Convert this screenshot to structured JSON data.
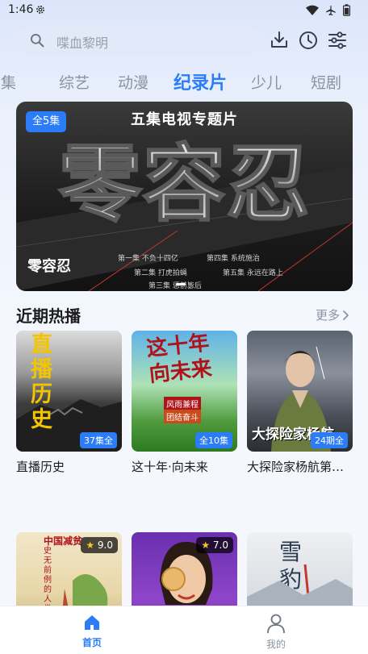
{
  "status_bar": {
    "time": "1:46"
  },
  "search": {
    "placeholder": "喋血黎明"
  },
  "tabs": [
    "剧集",
    "综艺",
    "动漫",
    "纪录片",
    "少儿",
    "短剧"
  ],
  "banner": {
    "badge": "全5集",
    "subtitle": "五集电视专题片",
    "big_title": "零容忍",
    "title": "零容忍",
    "episodes": [
      "第一集 不负十四亿",
      "第二集 打虎拍蝇",
      "第三集 惩前毖后",
      "第四集 系统施治",
      "第五集 永远在路上"
    ]
  },
  "section": {
    "title": "近期热播",
    "more": "更多"
  },
  "cards": [
    {
      "title": "直播历史",
      "badge": "37集全",
      "poster_text": "直播历史"
    },
    {
      "title": "这十年·向未来",
      "badge": "全10集",
      "poster_text": "这十年向未来",
      "poster_sub1": "风雨兼程",
      "poster_sub2": "团结奋斗"
    },
    {
      "title": "大探险家杨航第…",
      "badge": "24期全",
      "poster_text": "大探险家杨航"
    }
  ],
  "cards_row2": [
    {
      "rating": "9.0",
      "poster_text": "中国减贫",
      "poster_sub": "史无前例的人类奇迹"
    },
    {
      "rating": "7.0"
    },
    {
      "poster_text": "雪豹"
    }
  ],
  "colors": {
    "accent": "#2b7cf6",
    "muted": "#8a93a3"
  },
  "bottom_nav": {
    "home": "首页",
    "mine": "我的"
  }
}
